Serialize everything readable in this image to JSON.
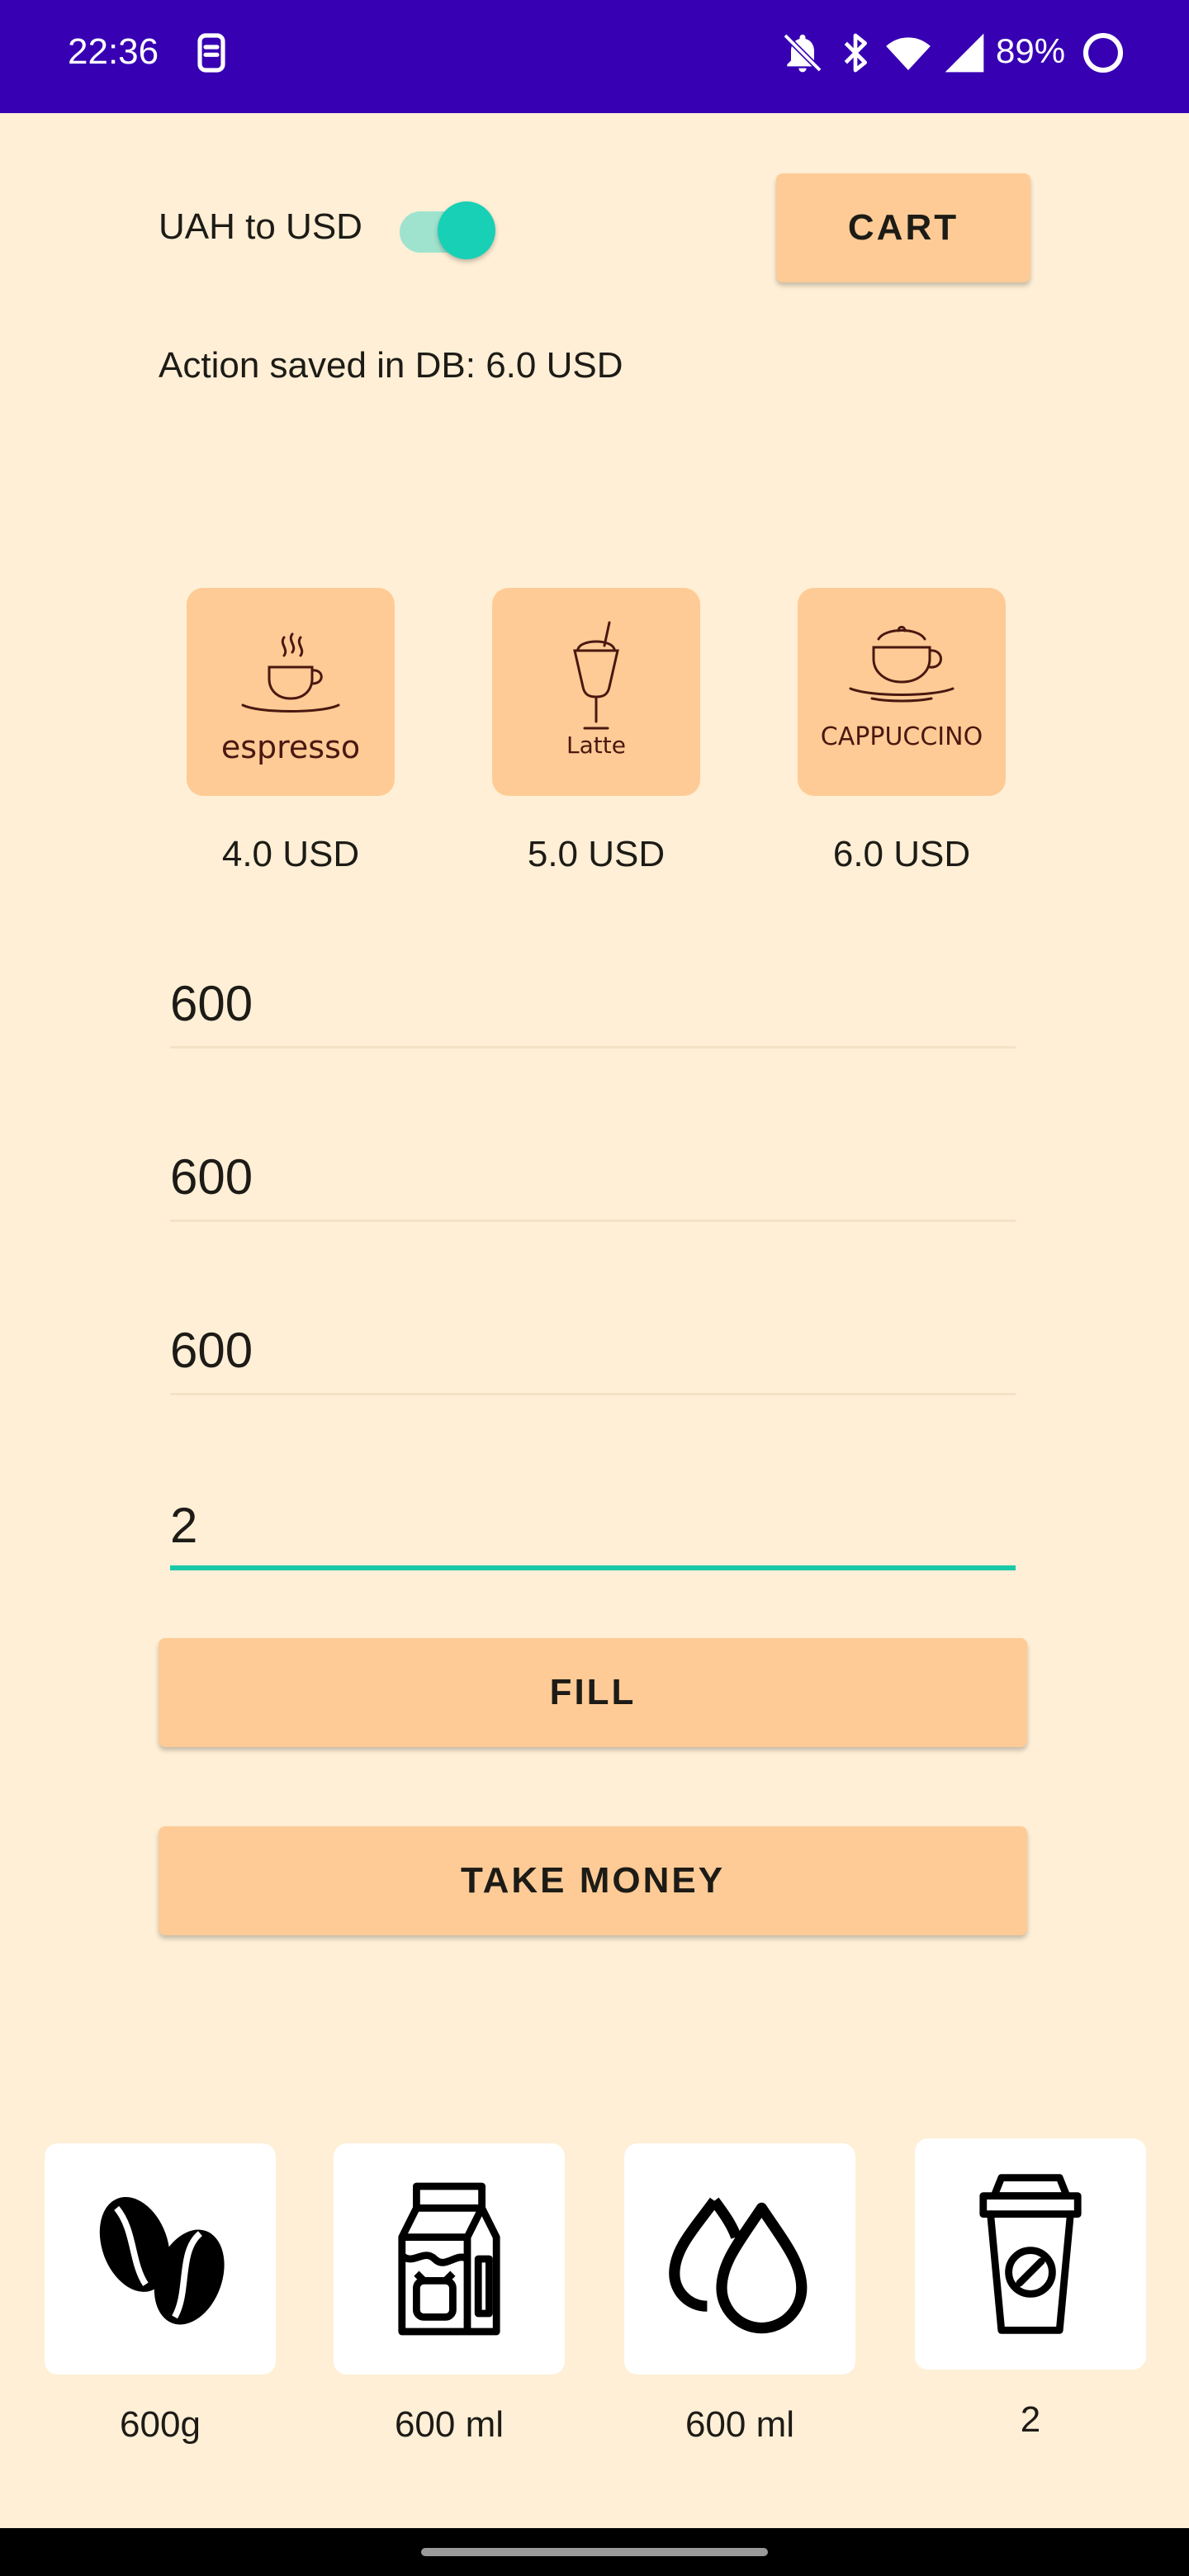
{
  "status_bar": {
    "time": "22:36",
    "battery": "89%",
    "icons": [
      "lock-phone-icon",
      "notifications-off-icon",
      "bluetooth-icon",
      "wifi-icon",
      "signal-icon",
      "battery-ring-icon"
    ],
    "background": "#3700B3"
  },
  "controls": {
    "currency_toggle_label": "UAH to USD",
    "currency_toggle_on": true,
    "cart_label": "CART"
  },
  "status_message": "Action saved in DB: 6.0 USD",
  "drinks": [
    {
      "name": "espresso",
      "price": "4.0 USD",
      "icon": "espresso-cup-icon"
    },
    {
      "name": "Latte",
      "price": "5.0 USD",
      "icon": "latte-glass-icon"
    },
    {
      "name": "CAPPUCCINO",
      "price": "6.0 USD",
      "icon": "cappuccino-cup-icon"
    }
  ],
  "inputs": [
    {
      "value": "600",
      "name": "coffee-beans"
    },
    {
      "value": "600",
      "name": "milk"
    },
    {
      "value": "600",
      "name": "water"
    },
    {
      "value": "2",
      "name": "cups"
    }
  ],
  "actions": {
    "fill_label": "FILL",
    "take_money_label": "TAKE MONEY"
  },
  "resources": [
    {
      "label": "600g",
      "icon": "coffee-beans-icon"
    },
    {
      "label": "600 ml",
      "icon": "milk-carton-icon"
    },
    {
      "label": "600 ml",
      "icon": "water-drops-icon"
    },
    {
      "label": "2",
      "icon": "coffee-cup-icon"
    }
  ],
  "colors": {
    "background": "#FEEFD6",
    "button": "#FECB96",
    "accent": "#18D0B5"
  }
}
